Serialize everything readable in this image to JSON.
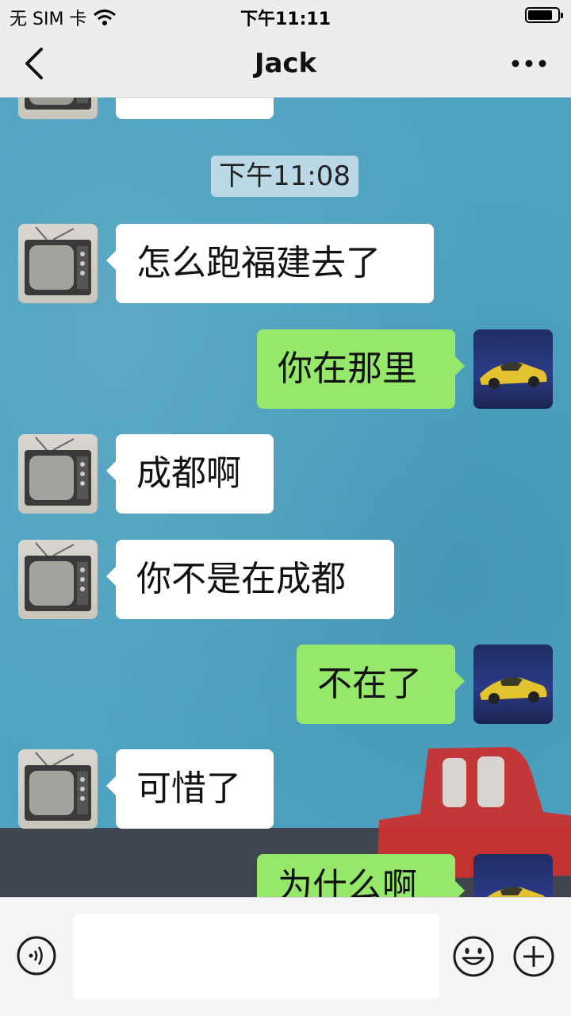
{
  "status_bar": {
    "carrier": "无 SIM 卡",
    "time": "下午11:11",
    "icons": [
      "wifi-icon",
      "battery-icon"
    ]
  },
  "nav": {
    "title": "Jack",
    "icons": [
      "back-chevron-icon",
      "more-dots-icon"
    ]
  },
  "chat": {
    "timestamp": "下午11:08",
    "contact_avatar": "tv-avatar",
    "self_avatar": "sports-car-avatar",
    "messages": [
      {
        "sender": "contact",
        "text": ""
      },
      {
        "sender": "contact",
        "text": "怎么跑福建去了"
      },
      {
        "sender": "self",
        "text": "你在那里"
      },
      {
        "sender": "contact",
        "text": "成都啊"
      },
      {
        "sender": "contact",
        "text": "你不是在成都"
      },
      {
        "sender": "self",
        "text": "不在了"
      },
      {
        "sender": "contact",
        "text": "可惜了"
      },
      {
        "sender": "self",
        "text": "为什么啊"
      }
    ]
  },
  "input_bar": {
    "text_value": "",
    "icons": [
      "voice-icon",
      "emoji-icon",
      "plus-icon"
    ]
  },
  "colors": {
    "chat_background": "#4ea2c1",
    "outgoing_bubble": "#95e86a",
    "incoming_bubble": "#ffffff",
    "bar_background": "#ededed"
  }
}
